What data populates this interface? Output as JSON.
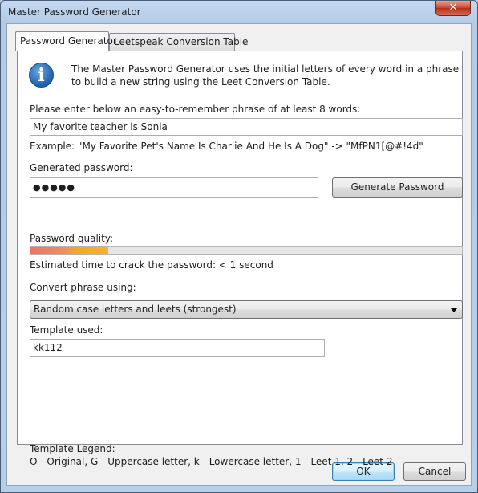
{
  "window": {
    "title": "Master Password Generator",
    "close_label": "✕"
  },
  "tabs": [
    {
      "label": "Password Generator",
      "active": true
    },
    {
      "label": "Leetspeak Conversion Table",
      "active": false
    }
  ],
  "info": {
    "icon": "info-icon",
    "line1": "The Master Password Generator uses the initial letters of every word in a phrase",
    "line2": "to build a new string using the Leet Conversion Table."
  },
  "phrase": {
    "label": "Please enter below an easy-to-remember phrase of at least 8 words:",
    "value": "My favorite teacher is Sonia",
    "example": "Example: \"My Favorite Pet's Name Is Charlie And He Is A Dog\" -> \"MfPN1[@#!4d\""
  },
  "generated": {
    "label": "Generated password:",
    "masked_value": "●●●●●",
    "button": "Generate Password"
  },
  "quality": {
    "label": "Password quality:",
    "level_percent": 18,
    "crack_time": "Estimated time to crack the password: < 1 second"
  },
  "convert": {
    "label": "Convert phrase using:",
    "selected": "Random case letters and leets (strongest)"
  },
  "template": {
    "label": "Template used:",
    "value": "kk112"
  },
  "legend": {
    "title": "Template Legend:",
    "text": "O - Original, G - Uppercase letter, k - Lowercase letter, 1 - Leet 1, 2 - Leet 2"
  },
  "buttons": {
    "ok": "OK",
    "cancel": "Cancel"
  }
}
